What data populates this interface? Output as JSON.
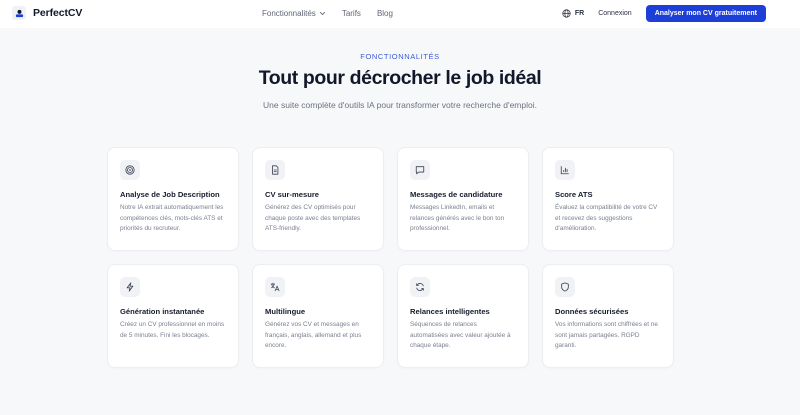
{
  "brand": {
    "name": "PerfectCV"
  },
  "nav": {
    "features": "Fonctionnalités",
    "pricing": "Tarifs",
    "blog": "Blog",
    "lang": "FR",
    "login": "Connexion",
    "cta": "Analyser mon CV gratuitement"
  },
  "hero": {
    "eyebrow": "FONCTIONNALITÉS",
    "title": "Tout pour décrocher le job idéal",
    "subtitle": "Une suite complète d'outils IA pour transformer votre recherche d'emploi."
  },
  "features": [
    {
      "icon": "target-icon",
      "title": "Analyse de Job Description",
      "desc": "Notre IA extrait automatiquement les compétences clés, mots-clés ATS et priorités du recruteur."
    },
    {
      "icon": "document-icon",
      "title": "CV sur-mesure",
      "desc": "Générez des CV optimisés pour chaque poste avec des templates ATS-friendly."
    },
    {
      "icon": "message-icon",
      "title": "Messages de candidature",
      "desc": "Messages LinkedIn, emails et relances générés avec le bon ton professionnel."
    },
    {
      "icon": "bar-chart-icon",
      "title": "Score ATS",
      "desc": "Évaluez la compatibilité de votre CV et recevez des suggestions d'amélioration."
    },
    {
      "icon": "lightning-icon",
      "title": "Génération instantanée",
      "desc": "Créez un CV professionnel en moins de 5 minutes. Fini les blocages."
    },
    {
      "icon": "translate-icon",
      "title": "Multilingue",
      "desc": "Générez vos CV et messages en français, anglais, allemand et plus encore."
    },
    {
      "icon": "refresh-icon",
      "title": "Relances intelligentes",
      "desc": "Séquences de relances automatisées avec valeur ajoutée à chaque étape."
    },
    {
      "icon": "shield-icon",
      "title": "Données sécurisées",
      "desc": "Vos informations sont chiffrées et ne sont jamais partagées. RGPD garanti."
    }
  ]
}
